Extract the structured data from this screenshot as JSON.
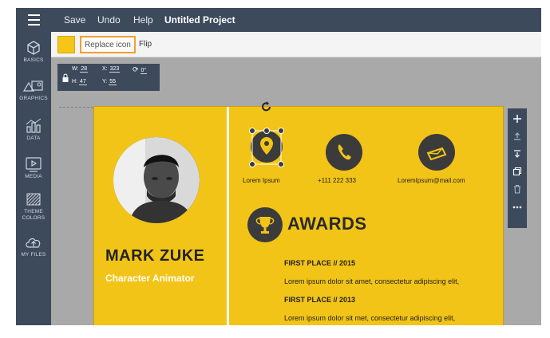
{
  "topbar": {
    "menu": [
      "Save",
      "Undo",
      "Help"
    ],
    "project_title": "Untitled Project"
  },
  "sidebar": {
    "items": [
      {
        "label": "BASICS",
        "icon": "cube-icon"
      },
      {
        "label": "GRAPHICS",
        "icon": "shapes-icon"
      },
      {
        "label": "DATA",
        "icon": "chart-icon"
      },
      {
        "label": "MEDIA",
        "icon": "play-icon"
      },
      {
        "label": "THEME COLORS",
        "icon": "palette-icon"
      },
      {
        "label": "MY FILES",
        "icon": "cloud-upload-icon"
      }
    ]
  },
  "toolbar": {
    "swatch_color": "#f5c518",
    "replace_label": "Replace icon",
    "flip_label": "Flip"
  },
  "dims": {
    "w_label": "W:",
    "w_value": "28",
    "x_label": "X:",
    "x_value": "323",
    "rot_value": "0°",
    "h_label": "H:",
    "h_value": "47",
    "y_label": "Y:",
    "y_value": "55"
  },
  "card": {
    "name": "MARK ZUKE",
    "role": "Character Animator",
    "contacts": [
      {
        "text": "Lorem Ipsum",
        "icon": "location-icon"
      },
      {
        "text": "+111 222 333",
        "icon": "phone-icon"
      },
      {
        "text": "LoremIpsum@mail.com",
        "icon": "email-icon"
      }
    ],
    "awards_title": "AWARDS",
    "awards": [
      {
        "heading": "FIRST PLACE // 2015",
        "desc": "Lorem ipsum dolor sit amet, consectetur adipiscing elit,"
      },
      {
        "heading": "FIRST PLACE // 2013",
        "desc": "Lorem ipsum dolor sit met, consectetur adipiscing elit,"
      }
    ]
  },
  "colors": {
    "accent": "#f2c417",
    "chrome": "#3d4a5c",
    "highlight": "#f0a030"
  }
}
